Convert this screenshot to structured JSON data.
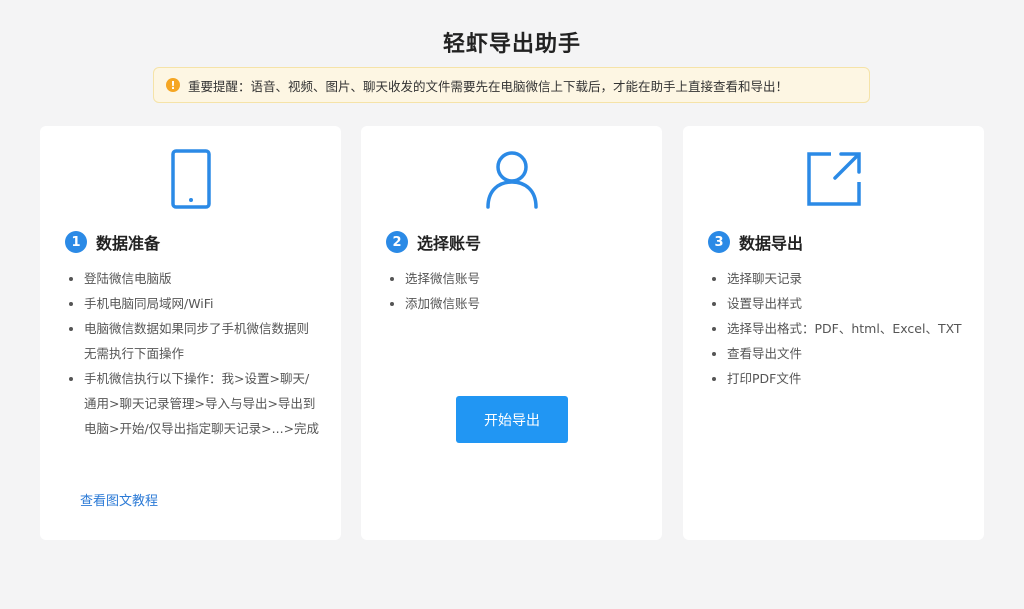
{
  "app": {
    "title": "轻虾导出助手"
  },
  "notice": {
    "text": "重要提醒：语音、视频、图片、聊天收发的文件需要先在电脑微信上下载后，才能在助手上直接查看和导出！"
  },
  "cards": [
    {
      "number": "1",
      "title": "数据准备",
      "icon": "phone-icon",
      "items": [
        "登陆微信电脑版",
        "手机电脑同局域网/WiFi",
        "电脑微信数据如果同步了手机微信数据则无需执行下面操作",
        "手机微信执行以下操作：我>设置>聊天/通用>聊天记录管理>导入与导出>导出到电脑>开始/仅导出指定聊天记录>...>完成"
      ],
      "link": "查看图文教程"
    },
    {
      "number": "2",
      "title": "选择账号",
      "icon": "user-icon",
      "items": [
        "选择微信账号",
        "添加微信账号"
      ],
      "button": "开始导出"
    },
    {
      "number": "3",
      "title": "数据导出",
      "icon": "export-icon",
      "items": [
        "选择聊天记录",
        "设置导出样式",
        "选择导出格式：PDF、html、Excel、TXT",
        "查看导出文件",
        "打印PDF文件"
      ]
    }
  ],
  "colors": {
    "accent": "#2196f3",
    "warning": "#f5a623",
    "noticeBg": "#fdf6e3"
  }
}
